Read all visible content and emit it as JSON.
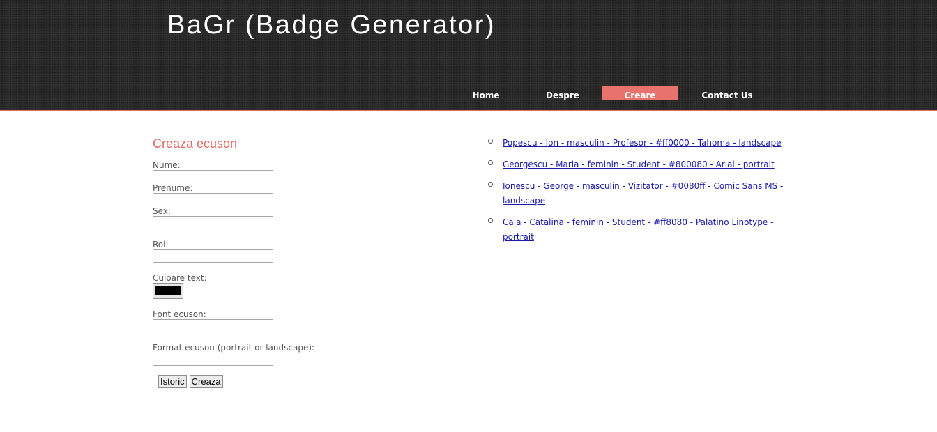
{
  "header": {
    "title": "BaGr (Badge Generator)",
    "nav": [
      {
        "label": "Home"
      },
      {
        "label": "Despre"
      },
      {
        "label": "Creare",
        "active": true
      },
      {
        "label": "Contact Us"
      }
    ]
  },
  "form": {
    "title": "Creaza ecuson",
    "fields": {
      "nume": {
        "label": "Nume:",
        "value": ""
      },
      "prenume": {
        "label": "Prenume:",
        "value": ""
      },
      "sex": {
        "label": "Sex:",
        "value": ""
      },
      "rol": {
        "label": "Rol:",
        "value": ""
      },
      "culoare": {
        "label": "Culoare text:",
        "value": "#000000"
      },
      "font": {
        "label": "Font ecuson:",
        "value": ""
      },
      "format": {
        "label": "Format ecuson (portrait or landscape):",
        "value": ""
      }
    },
    "buttons": {
      "istoric": "Istoric",
      "creaza": "Creaza"
    }
  },
  "history": [
    {
      "text": "Popescu - Ion - masculin - Profesor - #ff0000 - Tahoma - landscape"
    },
    {
      "text": "Georgescu - Maria - feminin - Student - #800080 - Arial - portrait"
    },
    {
      "text": "Ionescu - George - masculin - Vizitator - #0080ff - Comic Sans MS - landscape"
    },
    {
      "text": "Caia - Catalina - feminin - Student - #ff8080 - Palatino Linotype - portrait"
    }
  ],
  "colors": {
    "accent": "#e8736c",
    "header_bg": "#262626",
    "link": "#1a1aa6"
  }
}
